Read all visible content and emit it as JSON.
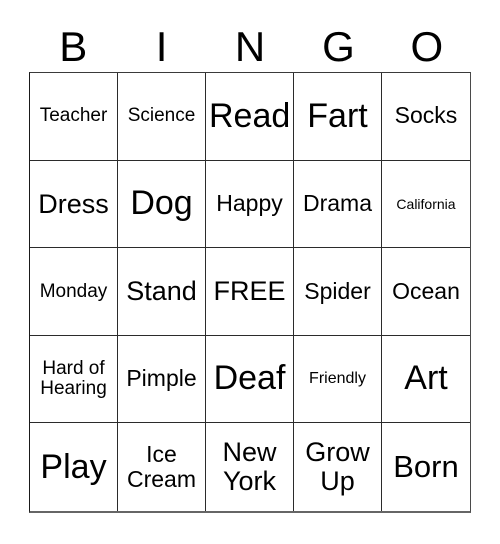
{
  "card": {
    "title": "BINGO",
    "header_letters": [
      "B",
      "I",
      "N",
      "G",
      "O"
    ],
    "free_space_label": "FREE",
    "colors": {
      "background": "#ffffff",
      "text": "#000000",
      "grid_line": "#2b2b2b"
    },
    "grid": {
      "columns": 5,
      "rows": 5,
      "cells": [
        {
          "text": "Teacher",
          "size": "sm",
          "lines": 1
        },
        {
          "text": "Science",
          "size": "sm",
          "lines": 1
        },
        {
          "text": "Read",
          "size": "xxl",
          "lines": 1
        },
        {
          "text": "Fart",
          "size": "xxl",
          "lines": 1
        },
        {
          "text": "Socks",
          "size": "md",
          "lines": 1
        },
        {
          "text": "Dress",
          "size": "lg",
          "lines": 1
        },
        {
          "text": "Dog",
          "size": "xxl",
          "lines": 1
        },
        {
          "text": "Happy",
          "size": "md",
          "lines": 1
        },
        {
          "text": "Drama",
          "size": "md",
          "lines": 1
        },
        {
          "text": "California",
          "size": "xxs",
          "lines": 1
        },
        {
          "text": "Monday",
          "size": "sm",
          "lines": 1
        },
        {
          "text": "Stand",
          "size": "lg",
          "lines": 1
        },
        {
          "text": "FREE",
          "size": "lg",
          "lines": 1
        },
        {
          "text": "Spider",
          "size": "md",
          "lines": 1
        },
        {
          "text": "Ocean",
          "size": "md",
          "lines": 1
        },
        {
          "text": "Hard of\nHearing",
          "size": "sm",
          "lines": 2
        },
        {
          "text": "Pimple",
          "size": "md",
          "lines": 1
        },
        {
          "text": "Deaf",
          "size": "xxl",
          "lines": 1
        },
        {
          "text": "Friendly",
          "size": "xs",
          "lines": 1
        },
        {
          "text": "Art",
          "size": "xxl",
          "lines": 1
        },
        {
          "text": "Play",
          "size": "xxl",
          "lines": 1
        },
        {
          "text": "Ice\nCream",
          "size": "md",
          "lines": 2
        },
        {
          "text": "New\nYork",
          "size": "lg",
          "lines": 2
        },
        {
          "text": "Grow\nUp",
          "size": "lg",
          "lines": 2
        },
        {
          "text": "Born",
          "size": "xl",
          "lines": 1
        }
      ]
    }
  }
}
